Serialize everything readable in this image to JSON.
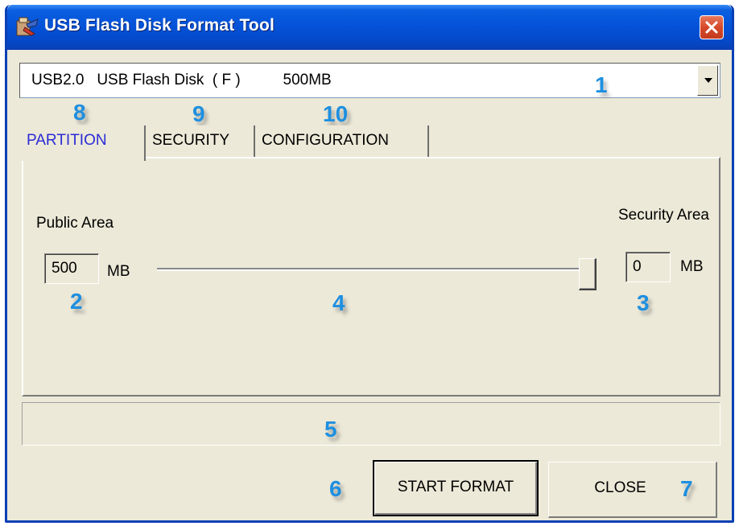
{
  "window": {
    "title": "USB Flash Disk Format Tool",
    "icon": "usb-tool-icon",
    "close_icon": "close-icon"
  },
  "device_select": {
    "value": "USB2.0   USB Flash Disk  ( F )          500MB",
    "dropdown_icon": "chevron-down-icon"
  },
  "tabs": [
    {
      "label": "PARTITION",
      "active": true
    },
    {
      "label": "SECURITY",
      "active": false
    },
    {
      "label": "CONFIGURATION",
      "active": false
    }
  ],
  "partition": {
    "public_area_label": "Public Area",
    "public_area_value": "500",
    "public_area_unit": "MB",
    "security_area_label": "Security Area",
    "security_area_value": "0",
    "security_area_unit": "MB",
    "slider_public_fraction": 1.0
  },
  "status_text": "",
  "buttons": {
    "start_format": "START FORMAT",
    "close": "CLOSE"
  },
  "callouts": [
    "1",
    "2",
    "3",
    "4",
    "5",
    "6",
    "7",
    "8",
    "9",
    "10"
  ],
  "colors": {
    "titlebar": "#0553d9",
    "callout": "#1e8fe0",
    "active_tab_text": "#2b2bd6",
    "close_button": "#d6492a",
    "window_bg": "#ece9d8"
  }
}
